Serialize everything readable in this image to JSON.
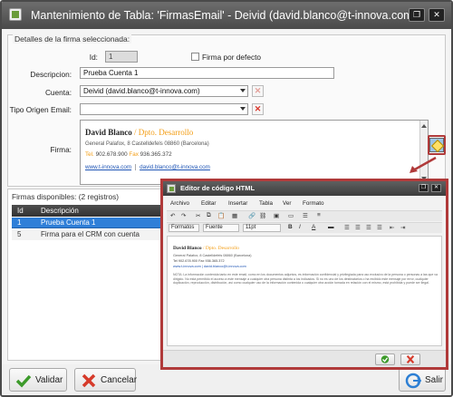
{
  "window": {
    "title": "Mantenimiento de Tabla: 'FirmasEmail' - Deivid (david.blanco@t-innova.com)",
    "restore_icon": "restore-icon",
    "close_icon": "close-icon"
  },
  "details": {
    "legend": "Detalles de la firma seleccionada:",
    "id_label": "Id:",
    "id_value": "1",
    "default_label": "Firma por defecto",
    "default_checked": false,
    "description_label": "Descripcion:",
    "description_value": "Prueba Cuenta 1",
    "account_label": "Cuenta:",
    "account_value": "Deivid (david.blanco@t-innova.com)",
    "origin_label": "Tipo Origen Email:",
    "origin_value": "",
    "signature_label": "Firma:"
  },
  "signature": {
    "name": "David Blanco",
    "separator": " / ",
    "department": "Dpto. Desarrollo",
    "address": "General Palafox, 8 Castelldefels 08860 (Barcelona)",
    "tel_label": "Tel.",
    "tel_value": "902.678.900",
    "fax_label": "Fax",
    "fax_value": "936.365.372",
    "link1": "www.t-innova.com",
    "link2": "david.blanco@t-innova.com"
  },
  "list": {
    "caption": "Firmas disponibles:  (2 registros)",
    "columns": [
      "Id",
      "Descripción"
    ],
    "rows": [
      {
        "id": "1",
        "description": "Prueba Cuenta 1"
      },
      {
        "id": "5",
        "description": "Firma para el CRM con cuenta"
      }
    ]
  },
  "buttons": {
    "validate": "Validar",
    "cancel": "Cancelar",
    "exit": "Salir"
  },
  "popup": {
    "title": "Editor de código HTML",
    "menu": [
      "Archivo",
      "Editar",
      "Insertar",
      "Tabla",
      "Ver",
      "Formato"
    ],
    "formats": "Formatos",
    "font": "Fuente",
    "size": "11pt",
    "editor": {
      "name": "David Blanco",
      "department": " / Dpto. Desarrollo",
      "address": "General Palafox, 8 Castelldefels 08860 (Barcelona)",
      "tel": "Tel 902.678.900 Fax 936.365.372",
      "links": "www.t-innova.com   |   david.blanco@t-innova.com",
      "note": "NOTA: La información contenida tanto en este email, como en los documentos adjuntos, es información confidencial y privilegiada para uso exclusivo de la persona o personas a las que va dirigido. No está permitido el acceso a este mensaje a cualquier otra persona distinta a los indicados. Si no es uno de los destinatarios o ha recibido este mensaje por error, cualquier duplicación, reproducción, distribución, así como cualquier uso de la información contenida o cualquier otra acción tomada en relación con el mismo, está prohibida y puede ser ilegal."
    }
  },
  "colors": {
    "accent_orange": "#f39c12",
    "selection_blue": "#2f7fd8",
    "callout_red": "#b03a3a"
  }
}
